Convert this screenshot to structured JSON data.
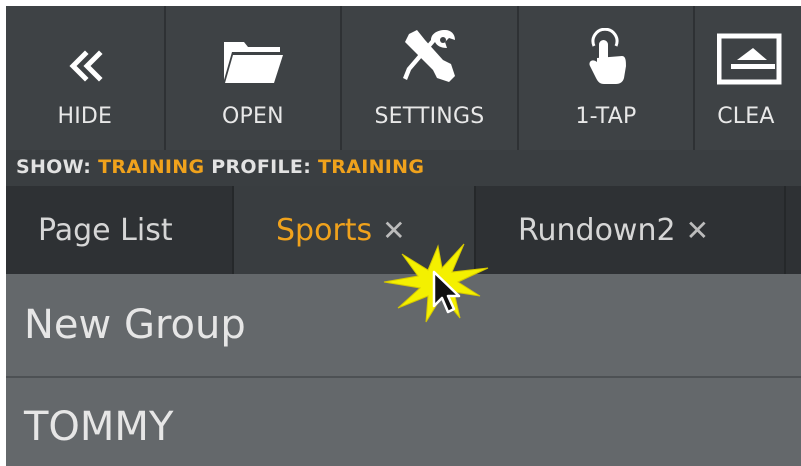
{
  "toolbar": {
    "items": [
      {
        "label": "HIDE",
        "icon": "double-chevron-left-icon"
      },
      {
        "label": "OPEN",
        "icon": "folder-icon"
      },
      {
        "label": "SETTINGS",
        "icon": "tools-icon"
      },
      {
        "label": "1-TAP",
        "icon": "tap-hand-icon"
      },
      {
        "label": "CLEA",
        "icon": "clean-icon"
      }
    ]
  },
  "showbar": {
    "show_prefix": "SHOW: ",
    "show_value": "TRAINING",
    "profile_prefix": " PROFILE: ",
    "profile_value": "TRAINING"
  },
  "tabs": [
    {
      "label": "Page List",
      "closable": false
    },
    {
      "label": "Sports",
      "closable": true,
      "close": "✕",
      "active": true
    },
    {
      "label": "Rundown2",
      "closable": true,
      "close": "✕"
    }
  ],
  "groups": [
    {
      "label": "New Group"
    },
    {
      "label": "TOMMY"
    }
  ],
  "colors": {
    "accent": "#f0a21c",
    "toolbar_bg": "#3e4245",
    "content_bg": "#64686b",
    "tab_bg": "#2e3134",
    "starburst": "#f4f000"
  }
}
